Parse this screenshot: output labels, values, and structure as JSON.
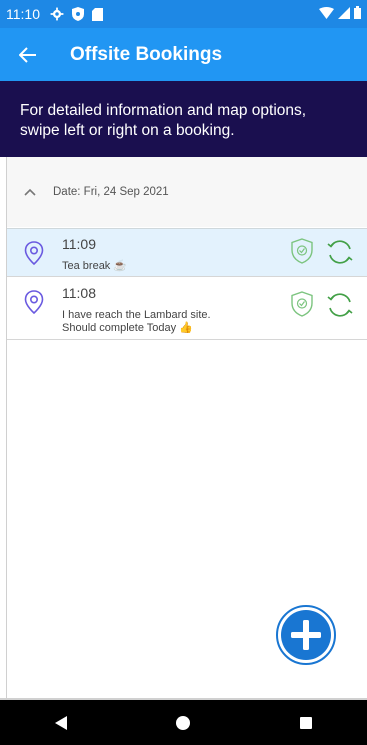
{
  "status_bar": {
    "time": "11:10",
    "icons": [
      "gear-icon",
      "shield-icon",
      "sd-card-icon",
      "wifi-icon",
      "signal-icon",
      "battery-icon"
    ]
  },
  "app_bar": {
    "title": "Offsite Bookings",
    "back_icon": "arrow-left-icon"
  },
  "banner": {
    "text": "For detailed information and map options, swipe left or right on a booking."
  },
  "bookings_group": {
    "date_label": "Date: Fri, 24 Sep 2021",
    "items": [
      {
        "time": "11:09",
        "note": "Tea break ☕",
        "selected": true
      },
      {
        "time": "11:08",
        "note_line1": "I have reach the Lambard site.",
        "note_line2": "Should complete Today 👍",
        "selected": false
      }
    ]
  },
  "colors": {
    "status_bar": "#1E88E5",
    "app_bar": "#2196F3",
    "banner": "#1A0F4F",
    "pin": "#6A5AE0",
    "shield": "#66BB6A",
    "sync": "#43A047",
    "fab": "#1976D2"
  },
  "fab": {
    "icon": "add-icon"
  },
  "nav": {
    "icons": [
      "back-triangle-icon",
      "home-circle-icon",
      "recents-square-icon"
    ]
  }
}
